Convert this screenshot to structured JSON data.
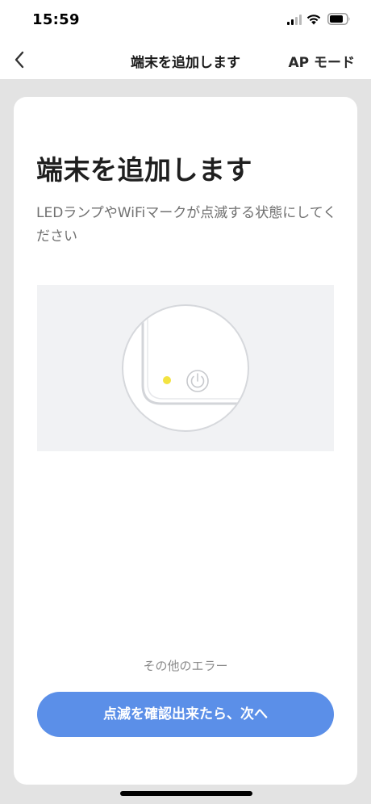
{
  "status_bar": {
    "time": "15:59",
    "icons": [
      "cellular-signal-icon",
      "wifi-icon",
      "battery-icon"
    ]
  },
  "nav": {
    "back_icon": "chevron-left-icon",
    "title": "端末を追加します",
    "right_action": "AP モード"
  },
  "content": {
    "heading": "端末を追加します",
    "instruction": "LEDランプやWiFiマークが点滅する状態にしてください",
    "illustration": {
      "icons": [
        "led-indicator-icon",
        "power-icon"
      ],
      "led_color": "#f3e341"
    },
    "other_error_link": "その他のエラー",
    "next_button": "点滅を確認出来たら、次へ"
  },
  "colors": {
    "primary_button": "#5b8fe8",
    "background": "#e3e3e3",
    "card": "#ffffff"
  }
}
